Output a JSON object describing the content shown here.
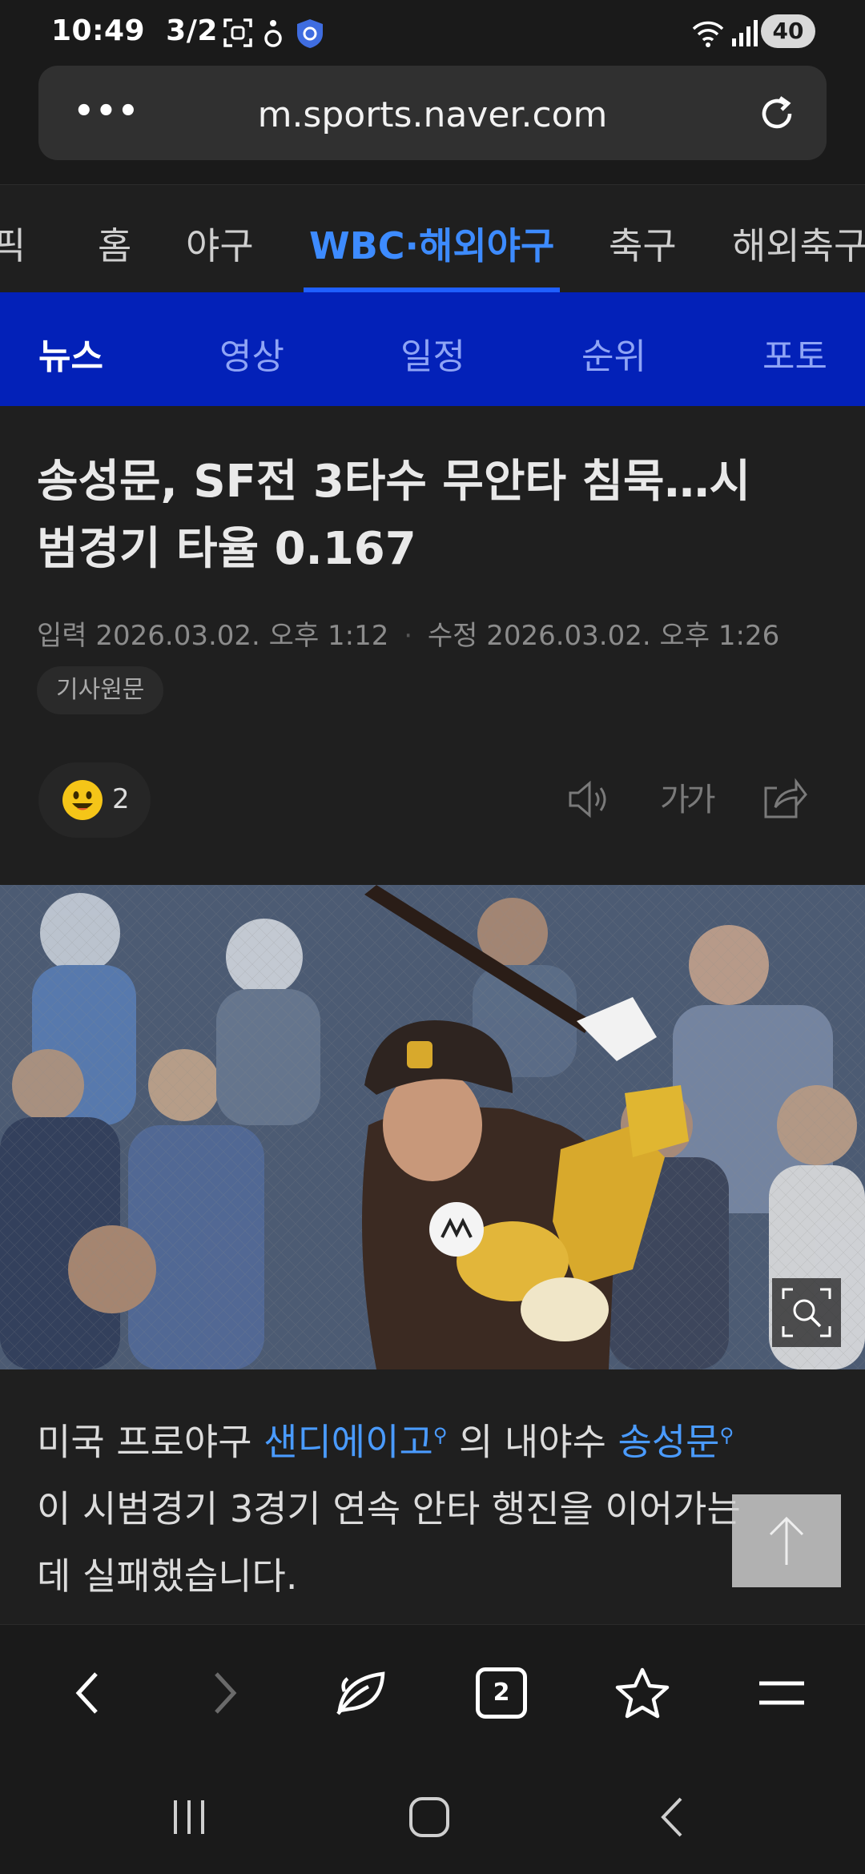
{
  "status_bar": {
    "time": "10:49",
    "date": "3/2",
    "battery": "40"
  },
  "browser": {
    "url": "m.sports.naver.com",
    "tab_count": "2"
  },
  "sport_nav": {
    "items": [
      "픽",
      "홈",
      "야구",
      "WBC·해외야구",
      "축구",
      "해외축구"
    ],
    "active": "WBC·해외야구"
  },
  "sub_tabs": {
    "items": [
      "뉴스",
      "영상",
      "일정",
      "순위",
      "포토"
    ],
    "active": "뉴스"
  },
  "article": {
    "headline_line1": "송성문, SF전 3타수 무안타 침묵…시",
    "headline_line2": "범경기 타율 0.167",
    "input_label": "입력",
    "input_time": "2026.03.02. 오후 1:12",
    "edit_label": "수정",
    "edit_time": "2026.03.02. 오후 1:26",
    "original_button": "기사원문",
    "reaction_count": "2",
    "font_size_label": "가가",
    "body_pre": "미국 프로야구 ",
    "body_link1": "샌디에이고",
    "body_mid": " 의 내야수 ",
    "body_link2": "송성문",
    "body_line2": "이 시범경기 3경기 연속 안타 행진을 이어가는",
    "body_line3": "데 실패했습니다."
  },
  "colors": {
    "accent_blue": "#3d8bff",
    "subtab_bg": "#0321b8",
    "background": "#1f1f1f"
  }
}
